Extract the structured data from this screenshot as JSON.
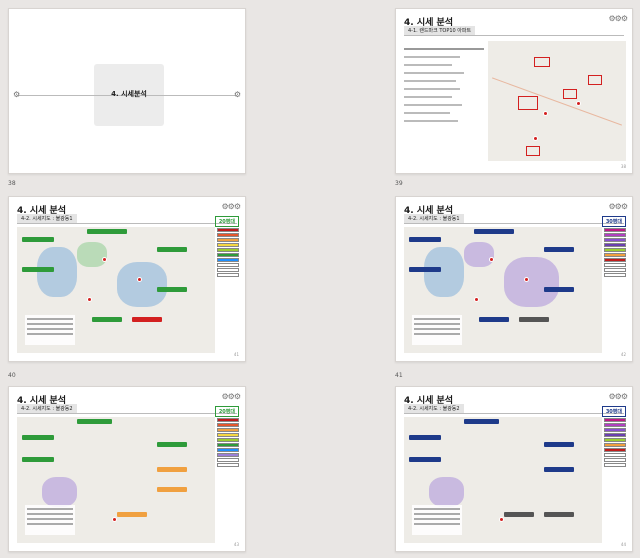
{
  "section_title": "4. 시세분석",
  "slides": [
    {
      "num": "38",
      "title": "4. 시세분석",
      "cover": true
    },
    {
      "num": "39",
      "title": "4. 시세 분석",
      "subtitle": "4-1. 랜드마크 TOP10 아파트",
      "page": "38"
    },
    {
      "num": "40",
      "title": "4. 시세 분석",
      "subtitle": "4-2. 시세지도 : 불광동1",
      "age": "20평대",
      "page": "41",
      "age_color": "#2e9b3a"
    },
    {
      "num": "41",
      "title": "4. 시세 분석",
      "subtitle": "4-2. 시세지도 : 불광동1",
      "age": "30평대",
      "page": "42",
      "age_color": "#1e3a8a"
    },
    {
      "num": "",
      "title": "4. 시세 분석",
      "subtitle": "4-2. 시세지도 : 불광동2",
      "age": "20평대",
      "page": "43",
      "age_color": "#2e9b3a"
    },
    {
      "num": "",
      "title": "4. 시세 분석",
      "subtitle": "4-2. 시세지도 : 불광동2",
      "age": "30평대",
      "page": "44",
      "age_color": "#1e3a8a"
    }
  ],
  "gear_glyph": "⚙⚙⚙",
  "colors": {
    "accent_green": "#2e9b3a",
    "accent_navy": "#1e3a8a",
    "red": "#d32020"
  }
}
